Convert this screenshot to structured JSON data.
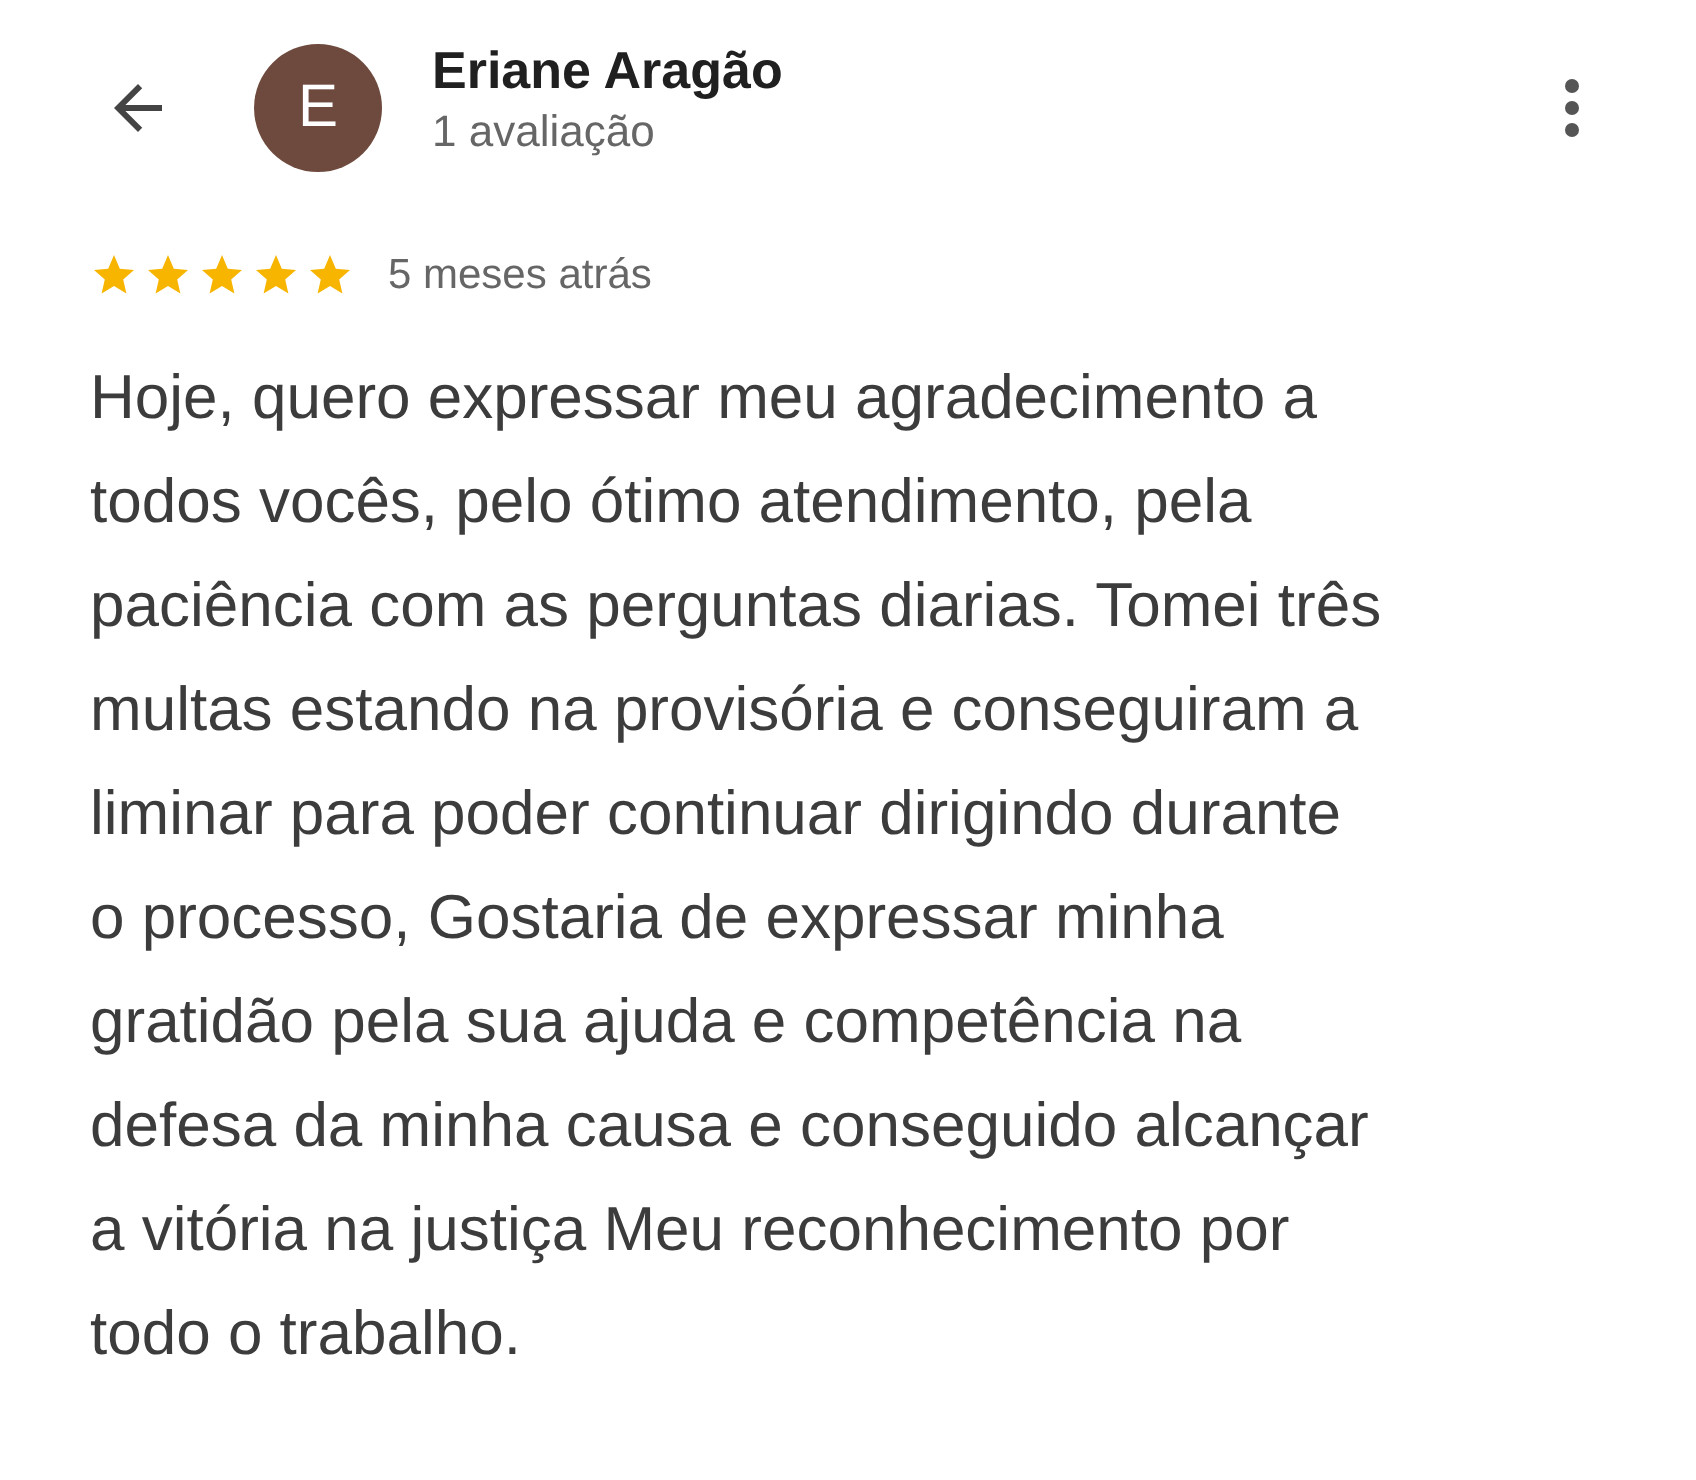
{
  "reviewer": {
    "initial": "E",
    "name": "Eriane Aragão",
    "review_count": "1 avaliação"
  },
  "review": {
    "stars": 5,
    "time": "5 meses atrás",
    "text_lines": [
      "Hoje, quero expressar meu agradecimento a",
      "todos vocês, pelo ótimo atendimento, pela",
      "paciência com as perguntas diarias. Tomei três",
      "multas estando na provisória e conseguiram a",
      "liminar para poder continuar dirigindo durante",
      "o processo, Gostaria de expressar minha",
      "gratidão pela sua ajuda e competência na",
      "defesa da minha causa e conseguido alcançar",
      "a vitória na justiça Meu reconhecimento por",
      "todo o trabalho."
    ]
  }
}
